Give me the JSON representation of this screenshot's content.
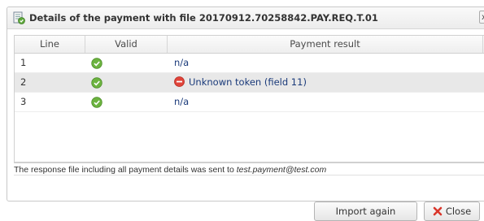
{
  "dialog": {
    "title": "Details of the payment with file 20170912.70258842.PAY.REQ.T.01",
    "close_glyph": "x"
  },
  "grid": {
    "columns": [
      "Line",
      "Valid",
      "Payment result"
    ],
    "rows": [
      {
        "line": "1",
        "valid_icon": "check-circle-icon",
        "result": "n/a",
        "result_icon": null
      },
      {
        "line": "2",
        "valid_icon": "check-circle-icon",
        "result": "Unknown token (field 11)",
        "result_icon": "error-circle-icon"
      },
      {
        "line": "3",
        "valid_icon": "check-circle-icon",
        "result": "n/a",
        "result_icon": null
      }
    ]
  },
  "footer": {
    "note_prefix": "The response file including all payment details was sent to ",
    "email": "test.payment@test.com"
  },
  "buttons": {
    "import_again": "Import again",
    "close": "Close"
  },
  "colors": {
    "valid_green": "#6cb33f",
    "error_red": "#e0443a",
    "result_text": "#1a3a7a",
    "highlight_row": "#e8e8e8"
  }
}
